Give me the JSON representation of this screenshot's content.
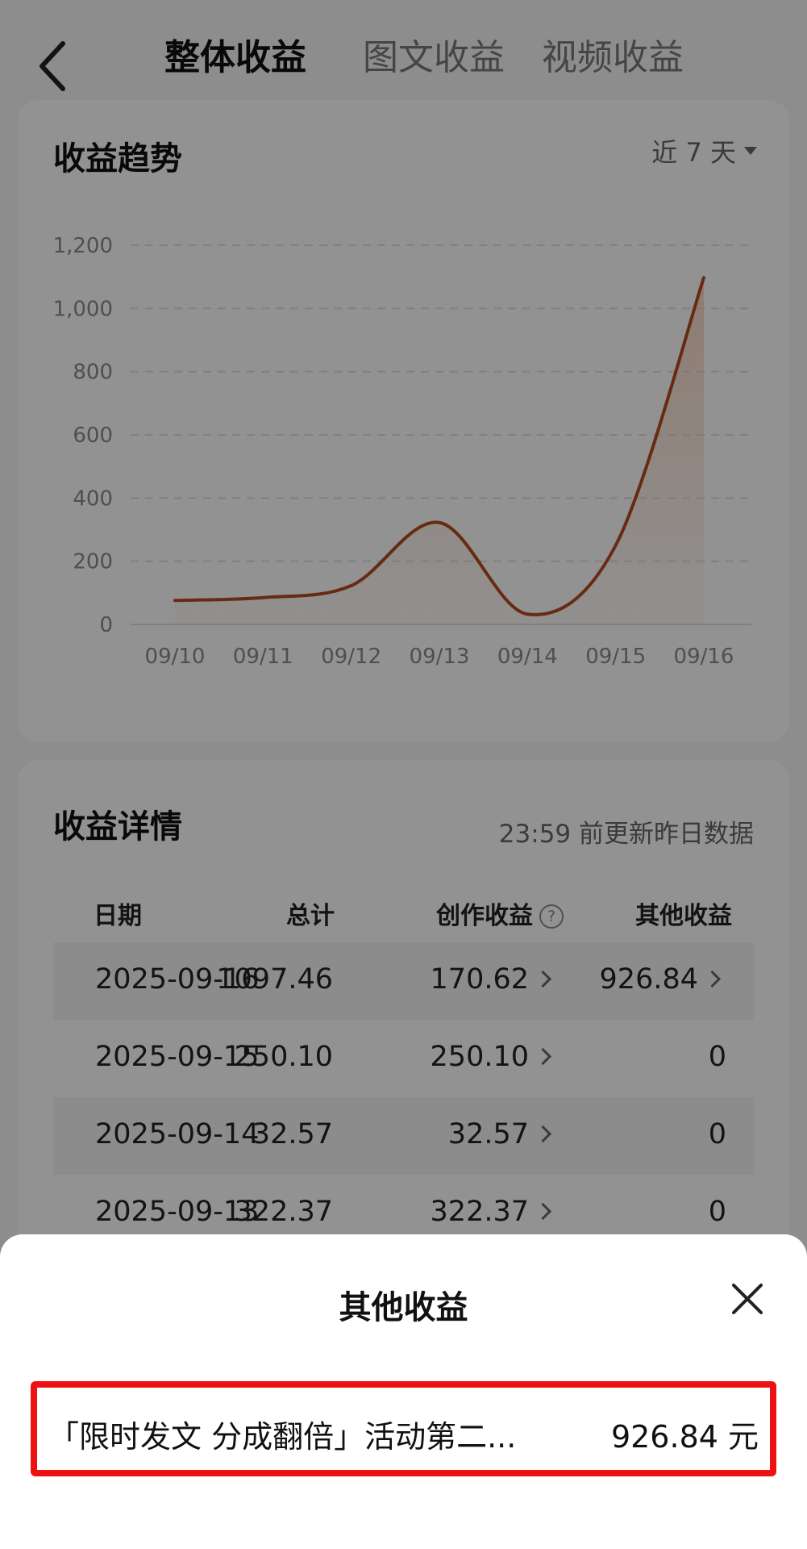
{
  "header": {
    "tabs": [
      {
        "label": "整体收益",
        "active": true
      },
      {
        "label": "图文收益",
        "active": false
      },
      {
        "label": "视频收益",
        "active": false
      }
    ]
  },
  "trend": {
    "title": "收益趋势",
    "range": "近 7 天"
  },
  "chart_data": {
    "type": "area",
    "title": "",
    "xlabel": "",
    "ylabel": "",
    "categories": [
      "09/10",
      "09/11",
      "09/12",
      "09/13",
      "09/14",
      "09/15",
      "09/16"
    ],
    "y_tick_labels": [
      "0",
      "200",
      "400",
      "600",
      "800",
      "1,000",
      "1,200"
    ],
    "values": [
      76,
      85,
      122.72,
      322.37,
      32.57,
      250.1,
      1097.46
    ],
    "ylim": [
      0,
      1200
    ],
    "grid": true,
    "colors": {
      "line": "#b24a20",
      "fill": "#f2c7ac"
    }
  },
  "details": {
    "title": "收益详情",
    "update_note": "23:59 前更新昨日数据",
    "columns": [
      "日期",
      "总计",
      "创作收益",
      "其他收益"
    ],
    "rows": [
      {
        "date": "2025-09-16",
        "total": "1097.46",
        "creation": "170.62",
        "other": "926.84"
      },
      {
        "date": "2025-09-15",
        "total": "250.10",
        "creation": "250.10",
        "other": "0"
      },
      {
        "date": "2025-09-14",
        "total": "32.57",
        "creation": "32.57",
        "other": "0"
      },
      {
        "date": "2025-09-13",
        "total": "322.37",
        "creation": "322.37",
        "other": "0"
      }
    ]
  },
  "sheet": {
    "title": "其他收益",
    "items": [
      {
        "name": "「限时发文 分成翻倍」活动第二...",
        "amount": "926.84 元"
      }
    ]
  }
}
